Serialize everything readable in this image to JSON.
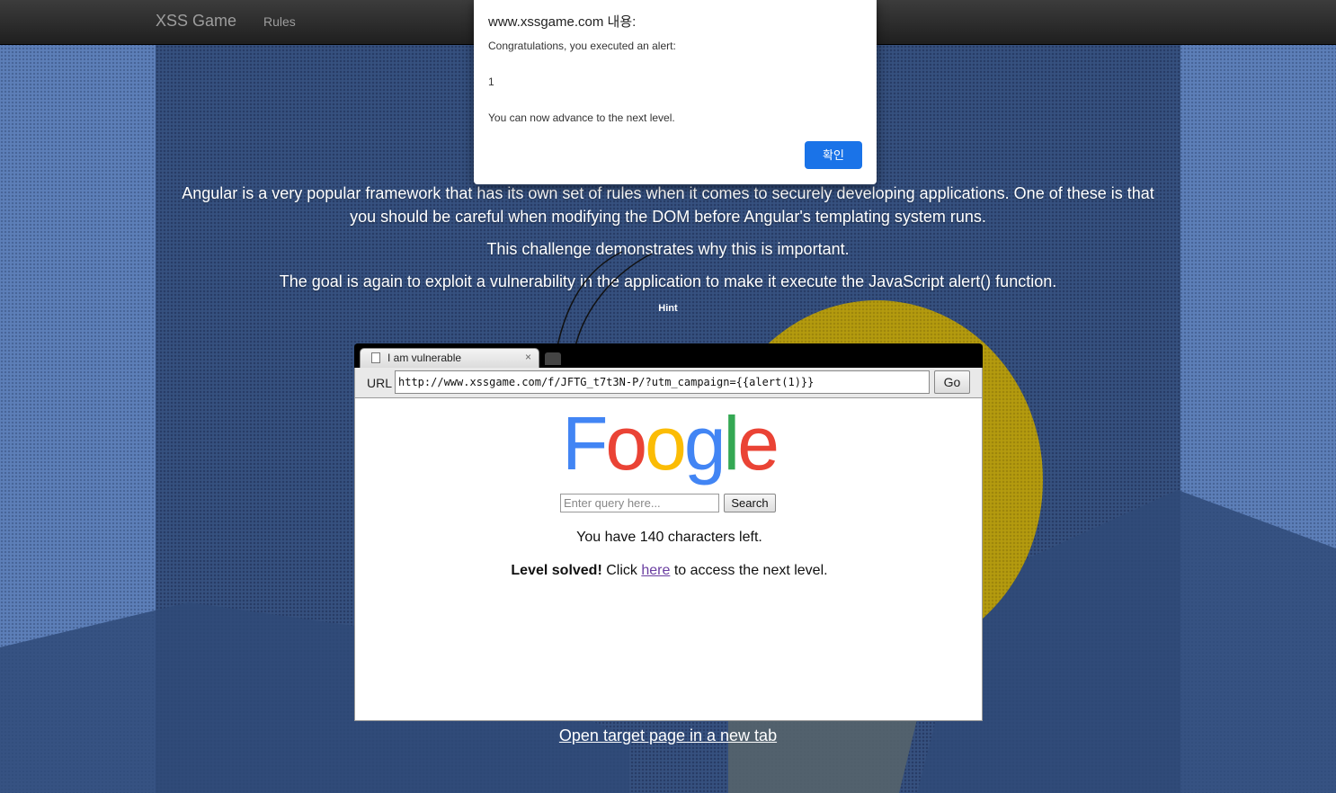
{
  "navbar": {
    "brand": "XSS Game",
    "rules": "Rules"
  },
  "intro": {
    "p1": "Angular is a very popular framework that has its own set of rules when it comes to securely developing applications. One of these is that you should be careful when modifying the DOM before Angular's templating system runs.",
    "p2": "This challenge demonstrates why this is important.",
    "p3": "The goal is again to exploit a vulnerability in the application to make it execute the JavaScript alert() function.",
    "hint": "Hint"
  },
  "browser": {
    "tab_title": "I am vulnerable",
    "tab_close": "×",
    "url_label": "URL",
    "url_value": "http://www.xssgame.com/f/JFTG_t7t3N-P/?utm_campaign={{alert(1)}}",
    "go": "Go"
  },
  "page": {
    "logo": [
      "F",
      "o",
      "o",
      "g",
      "l",
      "e"
    ],
    "logo_colors": [
      "#4285f4",
      "#ea4335",
      "#fbbc05",
      "#4285f4",
      "#34a853",
      "#ea4335"
    ],
    "query_placeholder": "Enter query here...",
    "search": "Search",
    "chars_left": "You have 140 characters left.",
    "solved_bold": "Level solved!",
    "solved_pre": " Click ",
    "solved_link": "here",
    "solved_post": " to access the next level."
  },
  "open_link": "Open target page in a new tab",
  "dialog": {
    "title": "www.xssgame.com 내용:",
    "msg1": "Congratulations, you executed an alert:",
    "msg2": "1",
    "msg3": "You can now advance to the next level.",
    "ok": "확인",
    "ok_color": "#1a73e8"
  }
}
